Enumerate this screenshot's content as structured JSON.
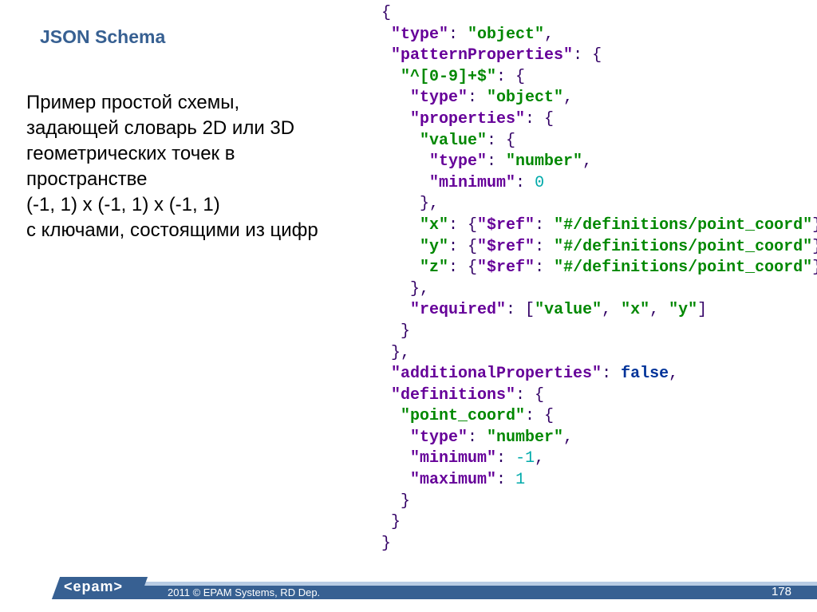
{
  "title": "JSON Schema",
  "description": "Пример простой схемы, задающей словарь 2D или 3D геометрических точек в пространстве\n(-1, 1) x (-1, 1) x (-1, 1)\nс ключами, состоящими из цифр",
  "schema": {
    "type_key": "\"type\"",
    "object_val": "\"object\"",
    "patternProp_key": "\"patternProperties\"",
    "pattern_key": "\"^[0-9]+$\"",
    "properties_key": "\"properties\"",
    "value_key": "\"value\"",
    "number_val": "\"number\"",
    "minimum_key": "\"minimum\"",
    "zero": "0",
    "x_key": "\"x\"",
    "y_key": "\"y\"",
    "z_key": "\"z\"",
    "ref_key": "\"$ref\"",
    "ref_val": "\"#/definitions/point_coord\"",
    "required_key": "\"required\"",
    "req_v": "\"value\"",
    "req_x": "\"x\"",
    "req_y": "\"y\"",
    "addProps_key": "\"additionalProperties\"",
    "false_kw": "false",
    "definitions_key": "\"definitions\"",
    "pointcoord_key": "\"point_coord\"",
    "maximum_key": "\"maximum\"",
    "neg1": "-1",
    "pos1": "1"
  },
  "footer": {
    "logo": "<epam>",
    "copyright": "2011 © EPAM Systems, RD Dep.",
    "page": "178"
  }
}
